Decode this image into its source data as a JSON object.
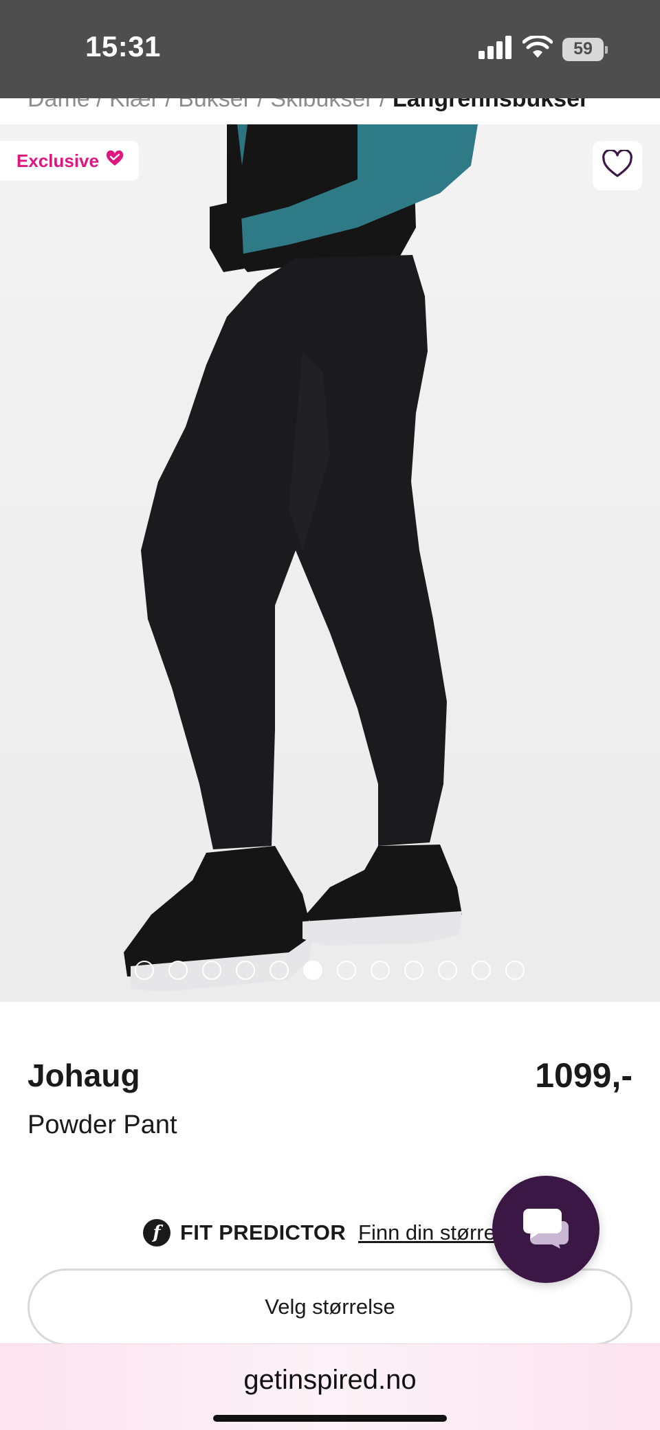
{
  "status_bar": {
    "time": "15:31",
    "battery": "59"
  },
  "breadcrumb": {
    "trail": "Dame / Klær / Bukser / Skibukser / ",
    "current": "Langrennsbukser"
  },
  "gallery": {
    "badge_label": "Exclusive",
    "image_count": 12,
    "active_image": 6
  },
  "product": {
    "brand": "Johaug",
    "price": "1099,-",
    "name": "Powder Pant"
  },
  "fit_predictor": {
    "label": "FIT PREDICTOR",
    "link": "Finn din størrelse"
  },
  "size_button": {
    "label": "Velg størrelse"
  },
  "browser": {
    "url": "getinspired.no"
  },
  "colors": {
    "badge_pink": "#e0157f",
    "chat_purple": "#3b1745",
    "url_bar_pink": "#fbe3ef"
  }
}
